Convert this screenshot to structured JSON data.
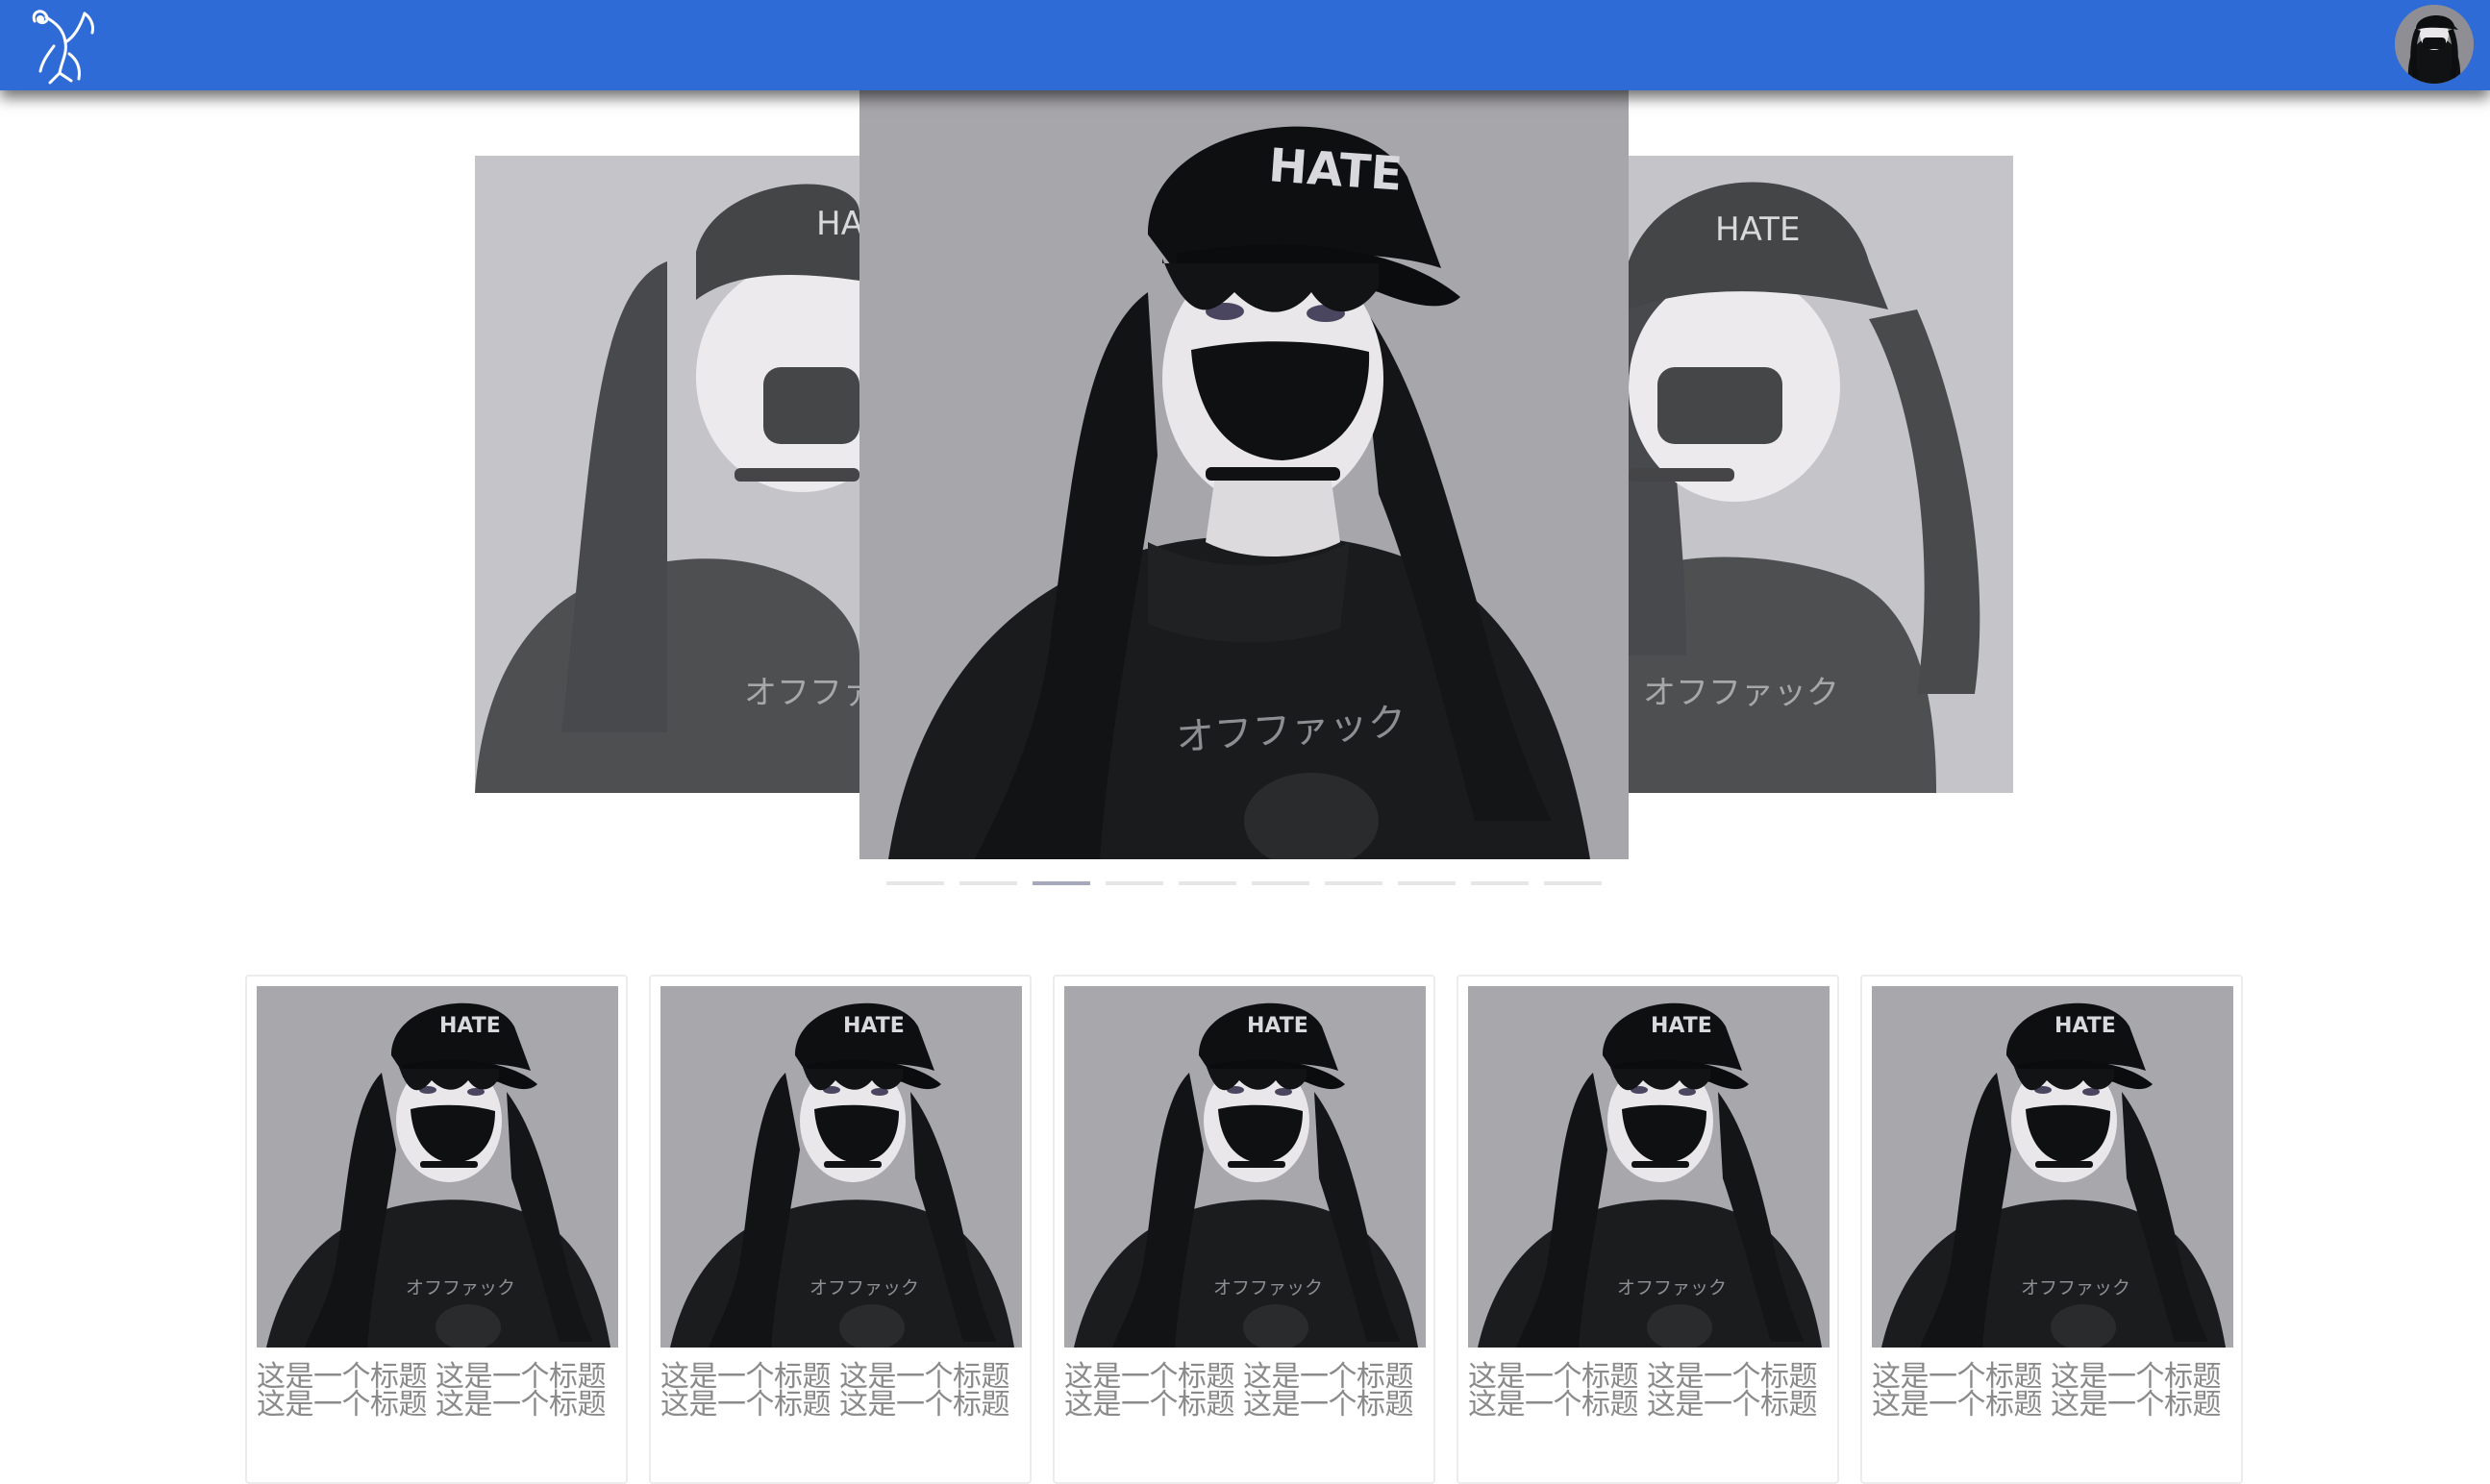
{
  "header": {
    "logo_icon": "dancer-logo-icon",
    "avatar_icon": "user-avatar-icon",
    "background_color": "#2f6bd6"
  },
  "carousel": {
    "slides": [
      {
        "label": "HATE",
        "shirt_text": "オフファック"
      },
      {
        "label": "HATE",
        "shirt_text": "オフファック"
      },
      {
        "label": "HATE",
        "shirt_text": "オフファック"
      }
    ],
    "indicator_count": 10,
    "active_index": 2
  },
  "cards": [
    {
      "title": "这是一个标题 这是一个标题 这是一个标题 这是一个标题",
      "cap_text": "HATE",
      "shirt_text": "オフファック"
    },
    {
      "title": "这是一个标题 这是一个标题 这是一个标题 这是一个标题",
      "cap_text": "HATE",
      "shirt_text": "オフファック"
    },
    {
      "title": "这是一个标题 这是一个标题 这是一个标题 这是一个标题",
      "cap_text": "HATE",
      "shirt_text": "オフファック"
    },
    {
      "title": "这是一个标题 这是一个标题 这是一个标题 这是一个标题",
      "cap_text": "HATE",
      "shirt_text": "オフファック"
    },
    {
      "title": "这是一个标题 这是一个标题 这是一个标题 这是一个标题",
      "cap_text": "HATE",
      "shirt_text": "オフファック"
    }
  ]
}
